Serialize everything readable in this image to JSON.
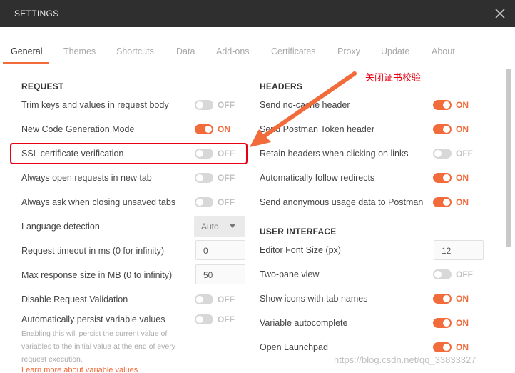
{
  "window": {
    "title": "SETTINGS",
    "close_icon": "close-icon"
  },
  "tabs": [
    {
      "label": "General",
      "active": true
    },
    {
      "label": "Themes"
    },
    {
      "label": "Shortcuts"
    },
    {
      "label": "Data"
    },
    {
      "label": "Add-ons"
    },
    {
      "label": "Certificates"
    },
    {
      "label": "Proxy"
    },
    {
      "label": "Update"
    },
    {
      "label": "About"
    }
  ],
  "request": {
    "title": "REQUEST",
    "settings": [
      {
        "label": "Trim keys and values in request body",
        "state": "OFF"
      },
      {
        "label": "New Code Generation Mode",
        "state": "ON"
      },
      {
        "label": "SSL certificate verification",
        "state": "OFF"
      },
      {
        "label": "Always open requests in new tab",
        "state": "OFF"
      },
      {
        "label": "Always ask when closing unsaved tabs",
        "state": "OFF"
      },
      {
        "label": "Language detection",
        "value": "Auto"
      },
      {
        "label": "Request timeout in ms (0 for infinity)",
        "value": "0"
      },
      {
        "label": "Max response size in MB (0 to infinity)",
        "value": "50"
      },
      {
        "label": "Disable Request Validation",
        "state": "OFF"
      },
      {
        "label": "Automatically persist variable values",
        "state": "OFF"
      }
    ],
    "persist_description": "Enabling this will persist the current value of variables to the initial value at the end of every request execution.",
    "learn_more": "Learn more about variable values"
  },
  "headers": {
    "title": "HEADERS",
    "settings": [
      {
        "label": "Send no-cache header",
        "state": "ON"
      },
      {
        "label": "Send Postman Token header",
        "state": "ON"
      },
      {
        "label": "Retain headers when clicking on links",
        "state": "OFF"
      },
      {
        "label": "Automatically follow redirects",
        "state": "ON"
      },
      {
        "label": "Send anonymous usage data to Postman",
        "state": "ON"
      }
    ]
  },
  "user_interface": {
    "title": "USER INTERFACE",
    "settings": [
      {
        "label": "Editor Font Size (px)",
        "value": "12"
      },
      {
        "label": "Two-pane view",
        "state": "OFF"
      },
      {
        "label": "Show icons with tab names",
        "state": "ON"
      },
      {
        "label": "Variable autocomplete",
        "state": "ON"
      },
      {
        "label": "Open Launchpad",
        "state": "ON"
      }
    ]
  },
  "annotation": {
    "text": "关闭证书校验",
    "color": "#e60012"
  },
  "watermark": "https://blog.csdn.net/qq_33833327",
  "colors": {
    "accent": "#f26b3a",
    "titlebar": "#2f2f2f",
    "annotation": "#e60012"
  }
}
